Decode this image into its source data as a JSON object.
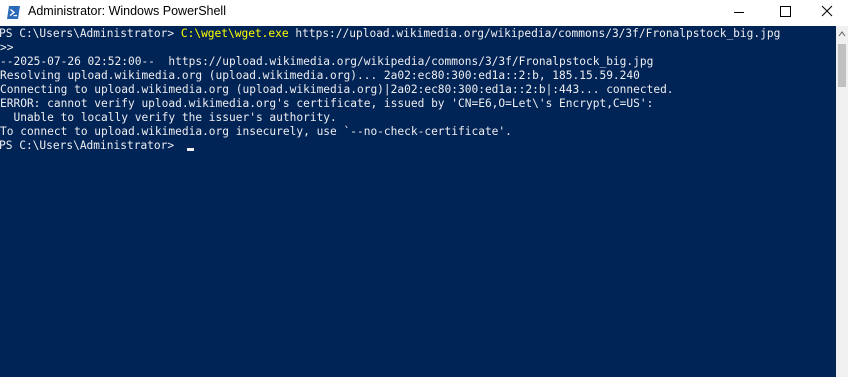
{
  "window": {
    "title": "Administrator: Windows PowerShell",
    "icons": {
      "app": "powershell-icon",
      "minimize": "minimize-icon",
      "maximize": "maximize-icon",
      "close": "close-icon"
    }
  },
  "console": {
    "line1": {
      "prompt": "PS C:\\Users\\Administrator> ",
      "command": "C:\\wget\\wget.exe",
      "args": " https://upload.wikimedia.org/wikipedia/commons/3/3f/Fronalpstock_big.jpg"
    },
    "line2": ">>",
    "line3": "--2025-07-26 02:52:00--  https://upload.wikimedia.org/wikipedia/commons/3/3f/Fronalpstock_big.jpg",
    "line4": "Resolving upload.wikimedia.org (upload.wikimedia.org)... 2a02:ec80:300:ed1a::2:b, 185.15.59.240",
    "line5": "Connecting to upload.wikimedia.org (upload.wikimedia.org)|2a02:ec80:300:ed1a::2:b|:443... connected.",
    "line6": "ERROR: cannot verify upload.wikimedia.org's certificate, issued by 'CN=E6,O=Let\\'s Encrypt,C=US':",
    "line7": "  Unable to locally verify the issuer's authority.",
    "line8": "To connect to upload.wikimedia.org insecurely, use `--no-check-certificate'.",
    "line9": "PS C:\\Users\\Administrator> "
  },
  "colors": {
    "console_background": "#012456",
    "console_text": "#eeedf0",
    "command_highlight": "#ffff00"
  }
}
